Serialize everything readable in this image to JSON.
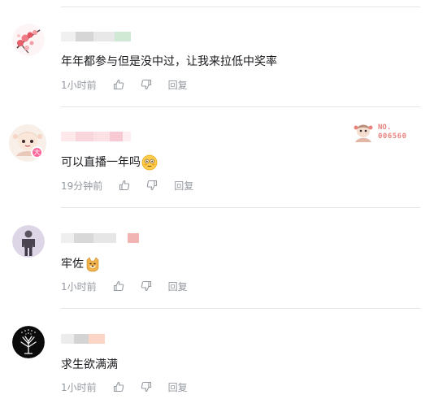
{
  "comments": [
    {
      "content": "年年都参与但是没中过，让我来拉低中奖率",
      "time": "1小时前",
      "reply": "回复",
      "avatar_icon": "cherry-blossom-avatar",
      "name_colors": [
        "#f0f0f0",
        "#d6d6d6",
        "#e8e8e8",
        "#cfe9d4"
      ]
    },
    {
      "content": "可以直播一年吗",
      "time": "19分钟前",
      "reply": "回复",
      "avatar_icon": "anime-character-avatar",
      "emoji": "flushed-face-emoji",
      "name_colors": [
        "#fde8ec",
        "#f9d5dd",
        "#fbe1e6",
        "#f6c9d3",
        "#ffeef1"
      ],
      "badge": {
        "line1": "NO.",
        "line2": "006560",
        "icon": "fan-badge-character-icon",
        "color": "#e8837e"
      }
    },
    {
      "content": "牢佐",
      "time": "1小时前",
      "reply": "回复",
      "avatar_icon": "standing-figure-avatar",
      "emoji": "doge-emoji",
      "name_colors": [
        "#efefef",
        "#d8d8d8",
        "#e6e6e6",
        "#f2b3b3"
      ]
    },
    {
      "content": "求生欲满满",
      "time": "1小时前",
      "reply": "回复",
      "avatar_icon": "white-tree-avatar",
      "name_colors": [
        "#ececec",
        "#d4d4d4",
        "#fbd6c6"
      ]
    }
  ],
  "colors": {
    "text": "#18191c",
    "meta": "#9499a0",
    "divider": "#e3e5e7"
  }
}
